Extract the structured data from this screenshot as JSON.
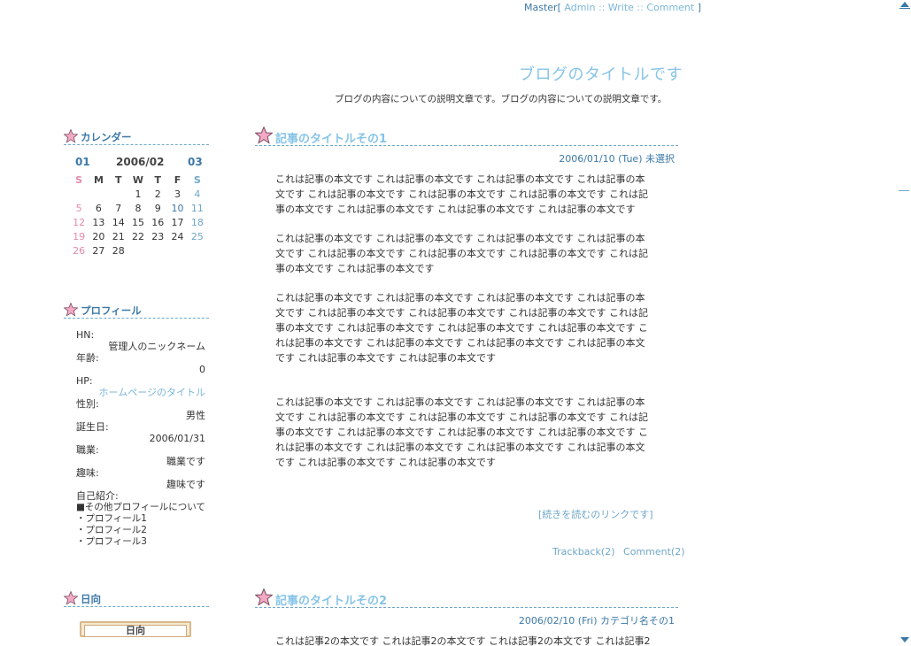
{
  "admin_links": {
    "master": "Master",
    "open": "[",
    "admin": "Admin",
    "sep1": "::",
    "write": "Write",
    "sep2": "::",
    "comment": "Comment",
    "close": "]"
  },
  "blog": {
    "title": "ブログのタイトルです",
    "description": "ブログの内容についての説明文章です。ブログの内容についての説明文章です。"
  },
  "calendar": {
    "heading": "カレンダー",
    "prev": "01",
    "current": "2006/02",
    "next": "03",
    "weekdays": [
      "S",
      "M",
      "T",
      "W",
      "T",
      "F",
      "S"
    ],
    "weeks": [
      [
        "",
        "",
        "",
        "1",
        "2",
        "3",
        "4"
      ],
      [
        "5",
        "6",
        "7",
        "8",
        "9",
        "10",
        "11"
      ],
      [
        "12",
        "13",
        "14",
        "15",
        "16",
        "17",
        "18"
      ],
      [
        "19",
        "20",
        "21",
        "22",
        "23",
        "24",
        "25"
      ],
      [
        "26",
        "27",
        "28",
        "",
        "",
        "",
        ""
      ]
    ]
  },
  "profile": {
    "heading": "プロフィール",
    "hn_label": "HN:",
    "hn_value": "管理人のニックネーム",
    "age_label": "年齢:",
    "age_value": "0",
    "hp_label": "HP:",
    "hp_value": "ホームページのタイトル",
    "gender_label": "性別:",
    "gender_value": "男性",
    "birthday_label": "誕生日:",
    "birthday_value": "2006/01/31",
    "job_label": "職業:",
    "job_value": "職業です",
    "hobby_label": "趣味:",
    "hobby_value": "趣味です",
    "intro_label": "自己紹介:",
    "intro_lines": [
      "■その他プロフィールについて",
      "・プロフィール1",
      "・プロフィール2",
      "・プロフィール3"
    ]
  },
  "hinata": {
    "heading": "日向",
    "plate": "日向"
  },
  "articles": [
    {
      "title": "記事のタイトルその1",
      "date": "2006/01/10 (Tue)",
      "category": "未選択",
      "paragraphs": [
        "これは記事の本文です これは記事の本文です これは記事の本文です これは記事の本文です これは記事の本文です これは記事の本文です これは記事の本文です これは記事の本文です これは記事の本文です これは記事の本文です これは記事の本文です",
        "これは記事の本文です これは記事の本文です これは記事の本文です これは記事の本文です これは記事の本文です これは記事の本文です これは記事の本文です これは記事の本文です これは記事の本文です",
        "これは記事の本文です これは記事の本文です これは記事の本文です これは記事の本文です これは記事の本文です これは記事の本文です これは記事の本文です これは記事の本文です これは記事の本文です これは記事の本文です これは記事の本文です これは記事の本文です これは記事の本文です これは記事の本文です これは記事の本文です これは記事の本文です これは記事の本文です",
        "これは記事の本文です これは記事の本文です これは記事の本文です これは記事の本文です これは記事の本文です これは記事の本文です これは記事の本文です これは記事の本文です これは記事の本文です これは記事の本文です これは記事の本文です これは記事の本文です これは記事の本文です これは記事の本文です これは記事の本文です これは記事の本文です これは記事の本文です"
      ],
      "readmore": "[続きを読むのリンクです]",
      "trackback": "Trackback(2)",
      "comment": "Comment(2)"
    },
    {
      "title": "記事のタイトルその2",
      "date": "2006/02/10 (Fri)",
      "category": "カテゴリ名その1",
      "first_line": "これは記事2の本文です これは記事2の本文です これは記事2の本文です これは記事2"
    }
  ],
  "colors": {
    "accent": "#86c4e8",
    "link": "#3c79a8",
    "sunday": "#e58aa6",
    "saturday": "#6fa7c9"
  }
}
